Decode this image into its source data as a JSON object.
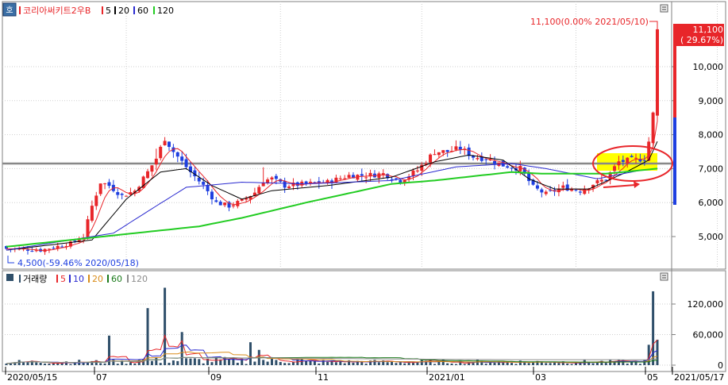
{
  "header": {
    "icon_label": "호",
    "title": "코리아써키트2우B",
    "ma_labels": [
      "5",
      "20",
      "60",
      "120"
    ]
  },
  "volume_header": {
    "title": "거래량",
    "ma_labels": [
      "5",
      "10",
      "20",
      "60",
      "120"
    ]
  },
  "colors": {
    "up": "#e8262a",
    "down": "#1e3fe0",
    "ma5": "#e8262a",
    "ma20": "#000000",
    "ma60": "#2a2ad0",
    "ma120": "#22cc22",
    "vol_ma5": "#e8262a",
    "vol_ma10": "#2a2ad0",
    "vol_ma20": "#d98c1a",
    "vol_ma60": "#1a7a1a",
    "vol_ma120": "#8c8c8c",
    "volume_bar": "#2f4f6a",
    "highlight_fill": "#ffff00",
    "circle_stroke": "#e8262a"
  },
  "annotations": {
    "high": "11,100(0.00% 2021/05/10)",
    "low": "4,500(-59.46% 2020/05/18)",
    "last_price": "11,100",
    "last_change": "( 29.67%)"
  },
  "chart_data": [
    {
      "type": "candlestick",
      "title": "코리아써키트2우B",
      "y_ticks": [
        5000,
        6000,
        7000,
        8000,
        9000,
        10000
      ],
      "y_tick_labels": [
        "5,000",
        "6,000",
        "7,000",
        "8,000",
        "9,000",
        "10,000"
      ],
      "ylim": [
        4100,
        11500
      ],
      "x_tick_labels": [
        "2020/05/15",
        "07",
        "09",
        "11",
        "2021/01",
        "03",
        "05",
        "2021/05/17"
      ],
      "reference_line": 7150,
      "high": {
        "value": 11100,
        "date": "2021/05/10"
      },
      "low": {
        "value": 4500,
        "date": "2020/05/18"
      },
      "last": {
        "value": 11100,
        "change_pct": 29.67
      },
      "price_path": [
        [
          0,
          4650
        ],
        [
          8,
          4600
        ],
        [
          15,
          4800
        ],
        [
          18,
          5000
        ],
        [
          20,
          5900
        ],
        [
          22,
          6600
        ],
        [
          24,
          6500
        ],
        [
          27,
          6200
        ],
        [
          30,
          6350
        ],
        [
          33,
          6900
        ],
        [
          35,
          7300
        ],
        [
          37,
          7900
        ],
        [
          39,
          7500
        ],
        [
          41,
          7200
        ],
        [
          43,
          6900
        ],
        [
          46,
          6500
        ],
        [
          49,
          6000
        ],
        [
          52,
          5900
        ],
        [
          55,
          6050
        ],
        [
          58,
          6300
        ],
        [
          60,
          6650
        ],
        [
          62,
          6700
        ],
        [
          65,
          6500
        ],
        [
          70,
          6550
        ],
        [
          75,
          6600
        ],
        [
          80,
          6800
        ],
        [
          84,
          6800
        ],
        [
          88,
          6850
        ],
        [
          92,
          6650
        ],
        [
          96,
          6950
        ],
        [
          100,
          7500
        ],
        [
          103,
          7500
        ],
        [
          106,
          7600
        ],
        [
          109,
          7350
        ],
        [
          112,
          7300
        ],
        [
          116,
          7100
        ],
        [
          120,
          7000
        ],
        [
          123,
          6450
        ],
        [
          126,
          6250
        ],
        [
          130,
          6450
        ],
        [
          134,
          6350
        ],
        [
          137,
          6550
        ],
        [
          140,
          6700
        ],
        [
          143,
          7200
        ],
        [
          146,
          7250
        ],
        [
          149,
          7300
        ],
        [
          150,
          7800
        ],
        [
          151,
          8600
        ],
        [
          152,
          11100
        ]
      ],
      "ma_paths": {
        "ma20": [
          [
            0,
            4600
          ],
          [
            20,
            4900
          ],
          [
            28,
            6100
          ],
          [
            36,
            6900
          ],
          [
            42,
            7000
          ],
          [
            48,
            6500
          ],
          [
            55,
            6100
          ],
          [
            62,
            6350
          ],
          [
            75,
            6500
          ],
          [
            90,
            6750
          ],
          [
            100,
            7200
          ],
          [
            108,
            7400
          ],
          [
            116,
            7250
          ],
          [
            122,
            6700
          ],
          [
            128,
            6400
          ],
          [
            136,
            6400
          ],
          [
            144,
            6850
          ],
          [
            150,
            7250
          ],
          [
            152,
            7800
          ]
        ],
        "ma60": [
          [
            0,
            4600
          ],
          [
            25,
            5100
          ],
          [
            35,
            5900
          ],
          [
            42,
            6450
          ],
          [
            55,
            6600
          ],
          [
            70,
            6550
          ],
          [
            90,
            6650
          ],
          [
            105,
            7050
          ],
          [
            118,
            7150
          ],
          [
            126,
            7000
          ],
          [
            138,
            6700
          ],
          [
            148,
            6950
          ],
          [
            152,
            7000
          ]
        ],
        "ma120": [
          [
            0,
            4700
          ],
          [
            30,
            5100
          ],
          [
            45,
            5300
          ],
          [
            55,
            5550
          ],
          [
            70,
            6000
          ],
          [
            90,
            6550
          ],
          [
            100,
            6650
          ],
          [
            118,
            6900
          ],
          [
            125,
            6850
          ],
          [
            140,
            6850
          ],
          [
            148,
            6950
          ],
          [
            152,
            7000
          ]
        ]
      }
    },
    {
      "type": "bar",
      "title": "거래량",
      "y_ticks": [
        0,
        60000,
        120000
      ],
      "y_tick_labels": [
        "0",
        "60,000",
        "120,000"
      ],
      "ylim": [
        0,
        165000
      ],
      "spikes": [
        {
          "index": 24,
          "value": 58000
        },
        {
          "index": 33,
          "value": 112000
        },
        {
          "index": 37,
          "value": 152000
        },
        {
          "index": 41,
          "value": 65000
        },
        {
          "index": 57,
          "value": 45000
        },
        {
          "index": 59,
          "value": 30000
        },
        {
          "index": 150,
          "value": 40000
        },
        {
          "index": 151,
          "value": 145000
        },
        {
          "index": 152,
          "value": 50000
        }
      ]
    }
  ]
}
